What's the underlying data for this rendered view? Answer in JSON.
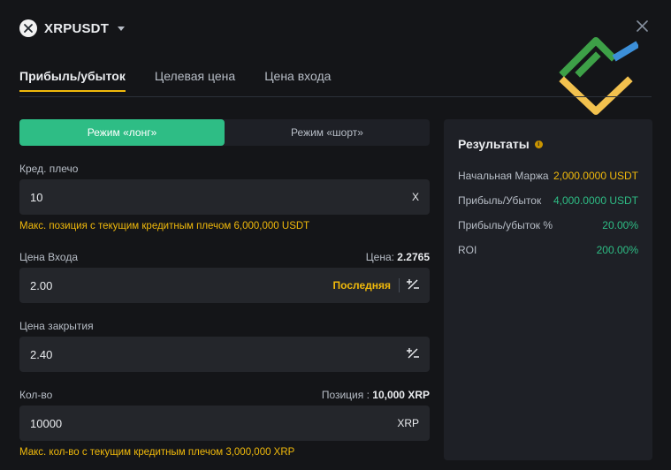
{
  "header": {
    "pair": "XRPUSDT"
  },
  "tabs": [
    {
      "label": "Прибыль/убыток"
    },
    {
      "label": "Целевая цена"
    },
    {
      "label": "Цена входа"
    }
  ],
  "mode": {
    "long": "Режим «лонг»",
    "short": "Режим «шорт»"
  },
  "leverage": {
    "label": "Кред. плечо",
    "value": "10",
    "suffix": "X",
    "warning": "Макс. позиция с текущим кредитным плечом 6,000,000 USDT"
  },
  "entry": {
    "label": "Цена Входа",
    "price_label": "Цена:",
    "price_value": "2.2765",
    "value": "2.00",
    "last_label": "Последняя",
    "toggle": "⁺∕₋"
  },
  "close_price": {
    "label": "Цена закрытия",
    "value": "2.40",
    "toggle": "⁺∕₋"
  },
  "qty": {
    "label": "Кол-во",
    "position_label": "Позиция :",
    "position_value": "10,000 XRP",
    "value": "10000",
    "suffix": "XRP",
    "warning": "Макс. кол-во с текущим кредитным плечом 3,000,000 XRP"
  },
  "results": {
    "title": "Результаты",
    "info": "i",
    "rows": [
      {
        "label": "Начальная Маржа",
        "value": "2,000.0000 USDT"
      },
      {
        "label": "Прибыль/Убыток",
        "value": "4,000.0000 USDT"
      },
      {
        "label": "Прибыль/убыток %",
        "value": "20.00%"
      },
      {
        "label": "ROI",
        "value": "200.00%"
      }
    ]
  },
  "colors": {
    "accent": "#f0b90b",
    "long": "#2ebd85",
    "panel": "#1e2026",
    "background": "#141518"
  }
}
